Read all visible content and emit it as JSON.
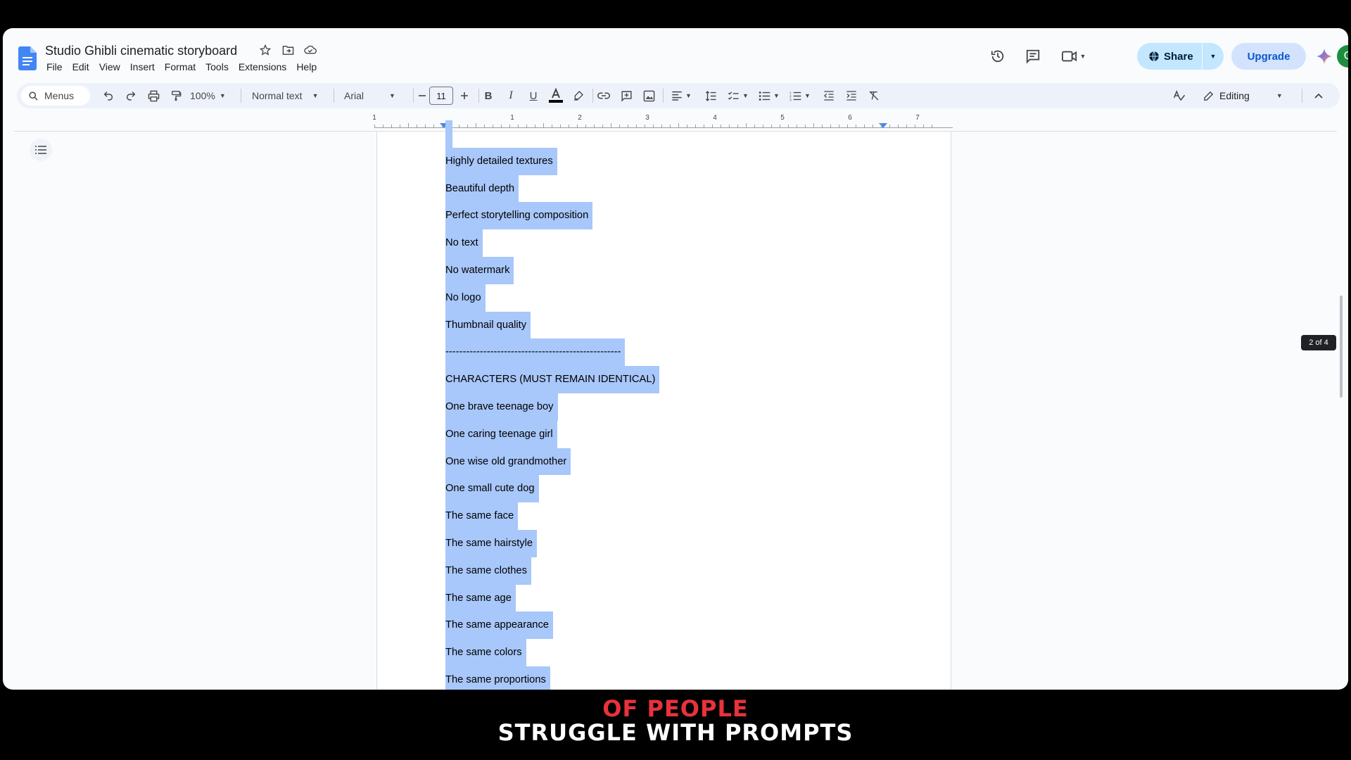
{
  "app": {
    "doc_title": "Studio Ghibli cinematic storyboard",
    "menus": [
      "File",
      "Edit",
      "View",
      "Insert",
      "Format",
      "Tools",
      "Extensions",
      "Help"
    ],
    "share_label": "Share",
    "upgrade_label": "Upgrade",
    "avatar_letter": "Q",
    "accent": "#0b57d0",
    "share_bg": "#c2e7ff",
    "selection_color": "#a8c7fa"
  },
  "toolbar": {
    "search_label": "Menus",
    "zoom": "100%",
    "style": "Normal text",
    "font": "Arial",
    "font_size": "11",
    "mode": "Editing"
  },
  "ruler": {
    "labels": [
      "1",
      "1",
      "2",
      "3",
      "4",
      "5",
      "6",
      "7"
    ]
  },
  "document": {
    "lines": [
      "Highly detailed textures",
      "Beautiful depth",
      "Perfect storytelling composition",
      "No text",
      "No watermark",
      "No logo",
      "Thumbnail quality",
      "---------------------------------------------------",
      "CHARACTERS (MUST REMAIN IDENTICAL)",
      "One brave teenage boy",
      "One caring teenage girl",
      "One wise old grandmother",
      "One small cute dog",
      "The same face",
      "The same hairstyle",
      "The same clothes",
      "The same age",
      "The same appearance",
      "The same colors",
      "The same proportions"
    ]
  },
  "page_indicator": "2 of 4",
  "caption": {
    "line1": "OF PEOPLE",
    "line2": "STRUGGLE WITH PROMPTS",
    "line1_color": "#e8323c",
    "line2_color": "#ffffff"
  }
}
